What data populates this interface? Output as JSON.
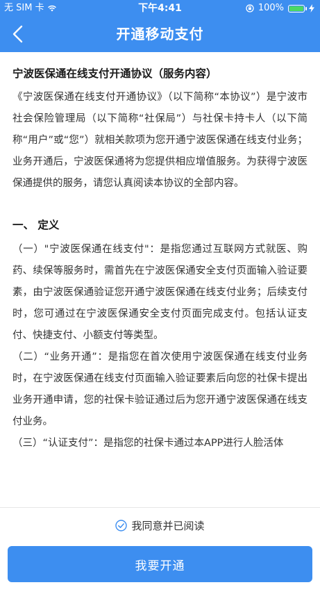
{
  "status_bar": {
    "carrier": "无 SIM 卡",
    "time": "下午4:41",
    "battery_percent": "100%",
    "battery_level": 1.0
  },
  "nav": {
    "title": "开通移动支付"
  },
  "agreement": {
    "title": "宁波医保通在线支付开通协议（服务内容）",
    "intro": "《宁波医保通在线支付开通协议》（以下简称“本协议”）是宁波市社会保险管理局（以下简称“社保局”）与社保卡持卡人（以下简称“用户”或“您”）就相关款项为您开通宁波医保通在线支付业务；业务开通后，宁波医保通将为您提供相应增值服务。为获得宁波医保通提供的服务，请您认真阅读本协议的全部内容。",
    "section1_title": "一、 定义",
    "section1_p1": "（一）\"宁波医保通在线支付\"：是指您通过互联网方式就医、购药、续保等服务时，需首先在宁波医保通安全支付页面输入验证要素，由宁波医保通验证您开通宁波医保通在线支付业务；后续支付时，您可通过在宁波医保通安全支付页面完成支付。包括认证支付、快捷支付、小额支付等类型。",
    "section1_p2": "（二）“业务开通”：是指您在首次使用宁波医保通在线支付业务时，在宁波医保通在线支付页面输入验证要素后向您的社保卡提出业务开通申请，您的社保卡验证通过后为您开通宁波医保通在线支付业务。",
    "section1_p3": "（三）“认证支付”：是指您的社保卡通过本APP进行人脸活体"
  },
  "footer": {
    "agree_label": "我同意并已阅读",
    "submit_label": "我要开通"
  },
  "colors": {
    "brand_blue": "#3d8ef0",
    "battery_green": "#4cd964"
  },
  "icons": [
    "wifi-icon",
    "lock-rotation-icon",
    "battery-icon",
    "charging-bolt-icon",
    "back-arrow-icon",
    "check-circle-icon"
  ]
}
